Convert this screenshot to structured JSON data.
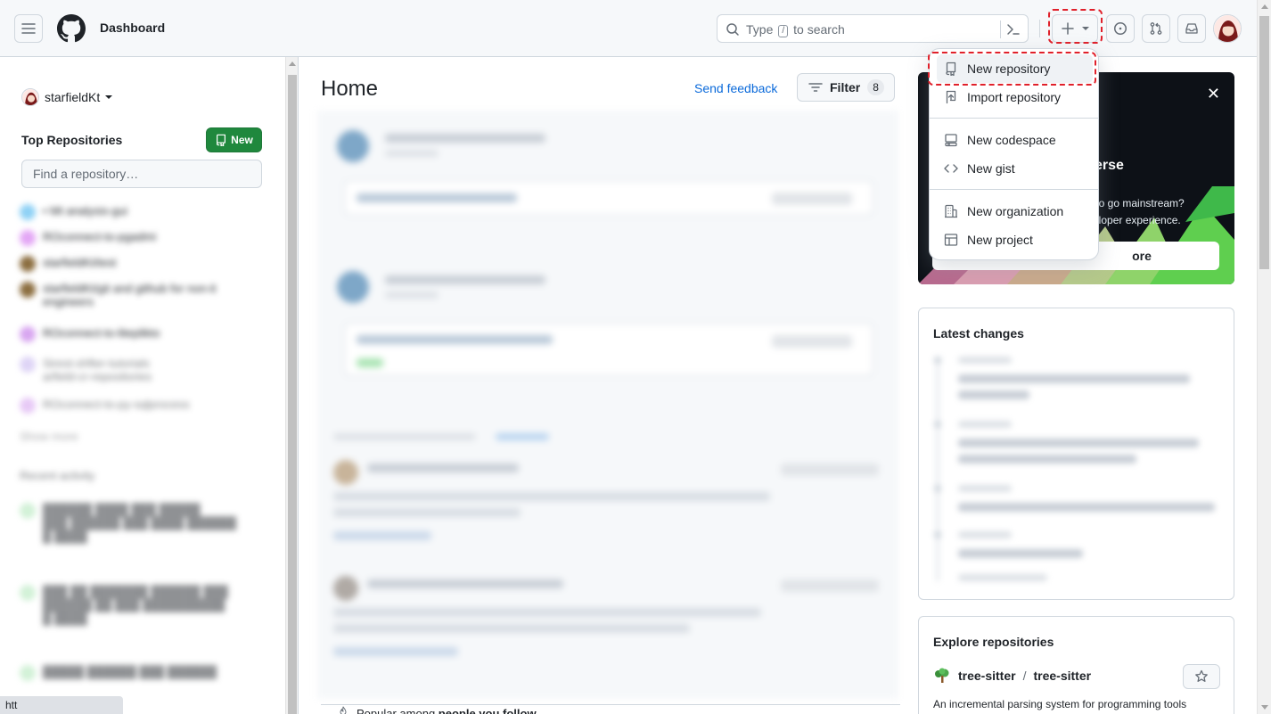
{
  "header": {
    "context": "Dashboard",
    "search": {
      "before": "Type",
      "key": "/",
      "after": "to search"
    }
  },
  "sidebar": {
    "username": "starfieldKt",
    "top_repositories_label": "Top Repositories",
    "new_button_label": "New",
    "find_placeholder": "Find a repository…"
  },
  "main": {
    "title": "Home",
    "send_feedback": "Send feedback",
    "filter_label": "Filter",
    "filter_count": "8",
    "popular_prefix": "Popular among",
    "popular_emph": "people you follow",
    "more_label": "..."
  },
  "create_menu": {
    "items": [
      {
        "label": "New repository",
        "icon": "repo-icon",
        "highlighted": true
      },
      {
        "label": "Import repository",
        "icon": "repo-push-icon"
      },
      {
        "label": "New codespace",
        "icon": "codespaces-icon"
      },
      {
        "label": "New gist",
        "icon": "code-icon"
      },
      {
        "label": "New organization",
        "icon": "organization-icon"
      },
      {
        "label": "New project",
        "icon": "table-icon"
      }
    ]
  },
  "promo": {
    "heading_fragment": "erse",
    "line1_fragment": "y to go mainstream?",
    "line2_fragment": "veloper experience.",
    "button_fragment": "ore"
  },
  "latest_changes": {
    "title": "Latest changes"
  },
  "explore": {
    "title": "Explore repositories",
    "repo_owner": "tree-sitter",
    "repo_name": "tree-sitter",
    "repo_desc": "An incremental parsing system for programming tools"
  },
  "status_bar": {
    "text": "htt"
  },
  "colors": {
    "primary_green": "#1f883d",
    "link_blue": "#0969da",
    "highlight_red": "#e0202a"
  }
}
